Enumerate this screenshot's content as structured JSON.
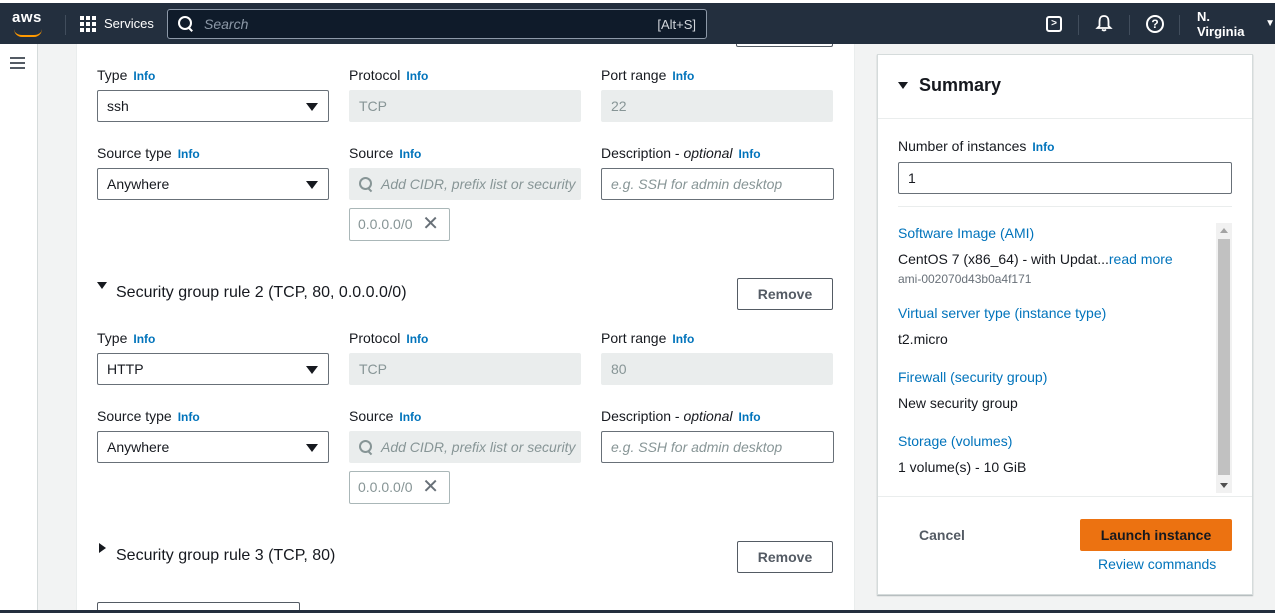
{
  "topnav": {
    "logo_text": "aws",
    "services_label": "Services",
    "search_placeholder": "Search",
    "search_shortcut": "[Alt+S]",
    "region_label": "N. Virginia",
    "icons": [
      "cloudshell-icon",
      "bell-icon",
      "help-icon"
    ]
  },
  "info_label": "Info",
  "rule1": {
    "type_label": "Type",
    "type_value": "ssh",
    "protocol_label": "Protocol",
    "protocol_value": "TCP",
    "port_label": "Port range",
    "port_value": "22",
    "source_type_label": "Source type",
    "source_type_value": "Anywhere",
    "source_label": "Source",
    "source_placeholder": "Add CIDR, prefix list or security",
    "source_token": "0.0.0.0/0",
    "desc_label": "Description",
    "desc_optional": "optional",
    "desc_placeholder": "e.g. SSH for admin desktop"
  },
  "rule2": {
    "title": "Security group rule 2 (TCP, 80, 0.0.0.0/0)",
    "remove_label": "Remove",
    "type_label": "Type",
    "type_value": "HTTP",
    "protocol_label": "Protocol",
    "protocol_value": "TCP",
    "port_label": "Port range",
    "port_value": "80",
    "source_type_label": "Source type",
    "source_type_value": "Anywhere",
    "source_label": "Source",
    "source_placeholder": "Add CIDR, prefix list or security",
    "source_token": "0.0.0.0/0",
    "desc_label": "Description",
    "desc_optional": "optional",
    "desc_placeholder": "e.g. SSH for admin desktop"
  },
  "rule3": {
    "title": "Security group rule 3 (TCP, 80)",
    "remove_label": "Remove"
  },
  "summary": {
    "title": "Summary",
    "instances_label": "Number of instances",
    "instances_value": "1",
    "ami_label": "Software Image (AMI)",
    "ami_value": "CentOS 7 (x86_64) - with Updat...",
    "ami_read_more": "read more",
    "ami_id": "ami-002070d43b0a4f171",
    "instance_type_label": "Virtual server type (instance type)",
    "instance_type_value": "t2.micro",
    "firewall_label": "Firewall (security group)",
    "firewall_value": "New security group",
    "storage_label": "Storage (volumes)",
    "storage_value": "1 volume(s) - 10 GiB",
    "cancel_label": "Cancel",
    "launch_label": "Launch instance",
    "review_label": "Review commands"
  },
  "colors": {
    "nav_bg": "#232f3e",
    "link": "#0073bb",
    "launch": "#ec7211"
  }
}
